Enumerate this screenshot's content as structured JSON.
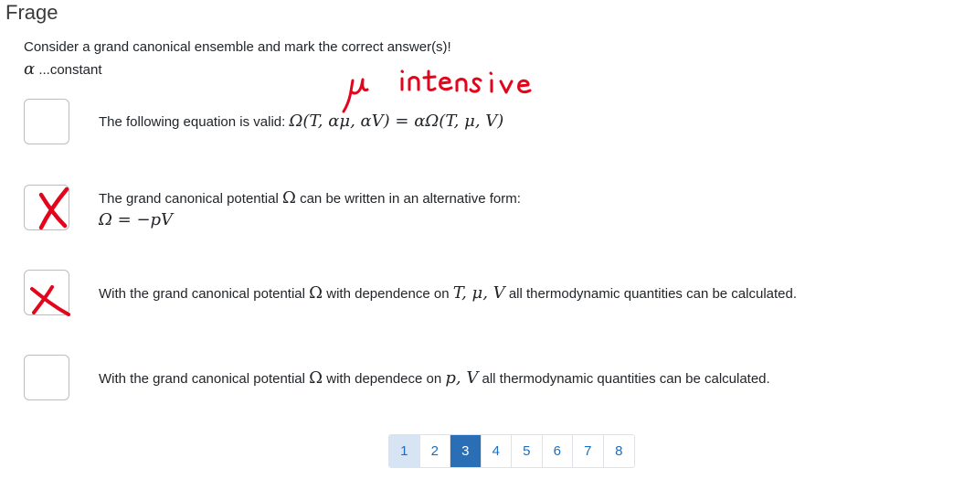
{
  "page": {
    "title": "Frage"
  },
  "question": {
    "prompt": "Consider a grand canonical ensemble and mark the correct answer(s)!",
    "note_symbol": "α",
    "note_text": " ...constant",
    "handwritten_note": "μ intensive"
  },
  "answers": [
    {
      "prefix": "The following equation is valid: ",
      "math": "Ω(T, αμ, αV) = αΩ(T, μ, V)",
      "checked": false
    },
    {
      "prefix": "The grand canonical potential ",
      "symbol": "Ω",
      "suffix": "  can be written in an alternative form:",
      "math": "Ω = −pV",
      "checked": true
    },
    {
      "prefix": "With the grand canonical potential ",
      "symbol": "Ω",
      "middle": "  with dependence on ",
      "vars": "T, μ, V",
      "suffix": "  all thermodynamic quantities can be calculated.",
      "checked": true
    },
    {
      "prefix": "With the grand canonical potential ",
      "symbol": "Ω",
      "middle": "  with dependece on ",
      "vars": "p, V",
      "suffix": "  all thermodynamic quantities can be calculated.",
      "checked": false
    }
  ],
  "pagination": {
    "pages": [
      "1",
      "2",
      "3",
      "4",
      "5",
      "6",
      "7",
      "8"
    ],
    "current": "3",
    "visited": [
      "1"
    ]
  },
  "colors": {
    "mark": "#e3051b",
    "pager_current": "#2a6eb5",
    "pager_visited": "#d6e4f3",
    "link": "#1b6ec2"
  }
}
